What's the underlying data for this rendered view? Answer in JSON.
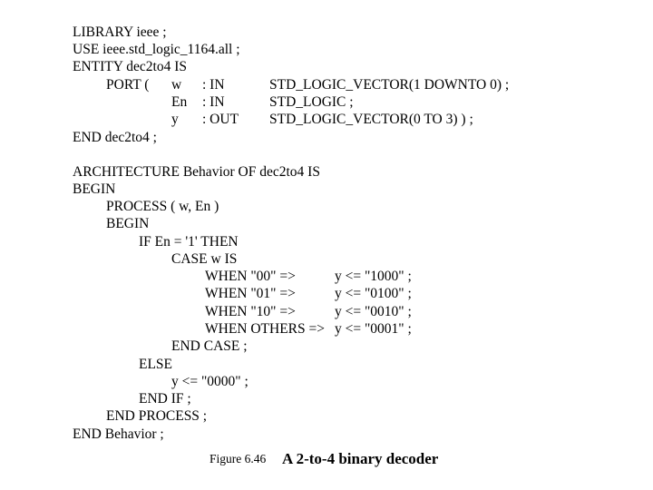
{
  "entity": {
    "library": "LIBRARY ieee ;",
    "use": "USE ieee.std_logic_1164.all ;",
    "entity_decl": "ENTITY dec2to4 IS",
    "port_keyword": "PORT (",
    "ports": [
      {
        "name": "w",
        "mode": ": IN",
        "type": "STD_LOGIC_VECTOR(1 DOWNTO 0) ;"
      },
      {
        "name": "En",
        "mode": ": IN",
        "type": "STD_LOGIC ;"
      },
      {
        "name": "y",
        "mode": ": OUT",
        "type": "STD_LOGIC_VECTOR(0 TO 3) ) ;"
      }
    ],
    "end": "END dec2to4 ;"
  },
  "architecture": {
    "header": "ARCHITECTURE Behavior OF dec2to4 IS",
    "begin": "BEGIN",
    "process": "PROCESS ( w, En )",
    "process_begin": "BEGIN",
    "if_line": "IF En = '1' THEN",
    "case_line": "CASE w IS",
    "when_cases": [
      {
        "when": "WHEN \"00\" =>",
        "assign": "y <= \"1000\" ;"
      },
      {
        "when": "WHEN \"01\" =>",
        "assign": "y <= \"0100\" ;"
      },
      {
        "when": "WHEN \"10\" =>",
        "assign": "y <= \"0010\" ;"
      },
      {
        "when": "WHEN OTHERS =>",
        "assign": "y <= \"0001\" ;"
      }
    ],
    "end_case": "END CASE ;",
    "else": "ELSE",
    "else_assign": "y <= \"0000\" ;",
    "end_if": "END IF ;",
    "end_process": "END PROCESS ;",
    "end": "END Behavior ;"
  },
  "caption": {
    "label": "Figure 6.46",
    "title": "A 2-to-4 binary decoder"
  }
}
